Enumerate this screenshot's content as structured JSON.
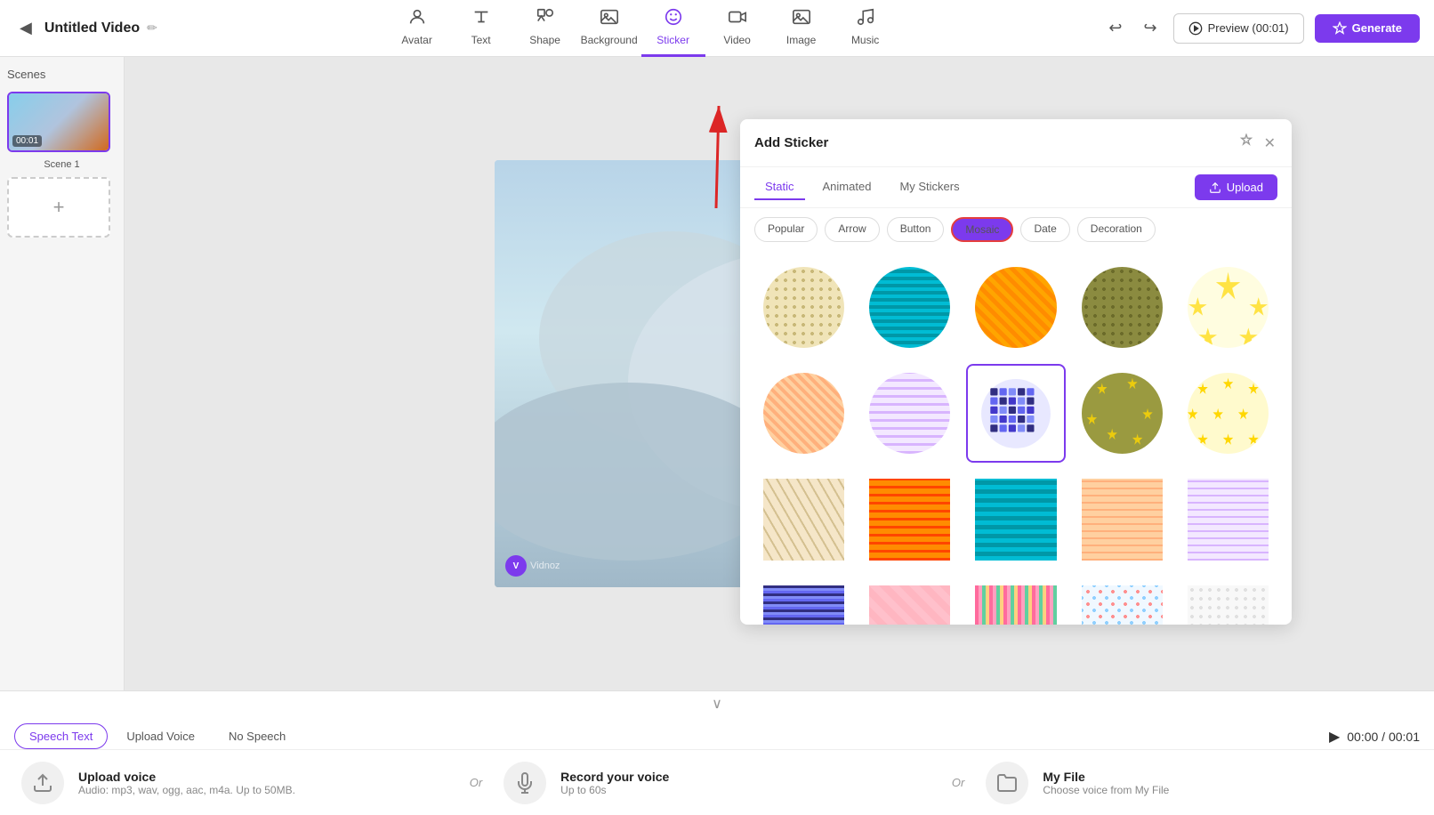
{
  "toolbar": {
    "back_icon": "◀",
    "title": "Untitled Video",
    "edit_icon": "✏",
    "tools": [
      {
        "id": "avatar",
        "icon": "👤",
        "label": "Avatar"
      },
      {
        "id": "text",
        "icon": "T",
        "label": "Text"
      },
      {
        "id": "shape",
        "icon": "⬡",
        "label": "Shape"
      },
      {
        "id": "background",
        "icon": "🖼",
        "label": "Background"
      },
      {
        "id": "sticker",
        "icon": "😊",
        "label": "Sticker",
        "active": true
      },
      {
        "id": "video",
        "icon": "▶",
        "label": "Video"
      },
      {
        "id": "image",
        "icon": "🖼",
        "label": "Image"
      },
      {
        "id": "music",
        "icon": "♪",
        "label": "Music"
      }
    ],
    "undo_icon": "↩",
    "redo_icon": "↪",
    "preview_label": "Preview (00:01)",
    "generate_label": "Generate"
  },
  "scenes": {
    "title": "Scenes",
    "items": [
      {
        "id": 1,
        "time": "00:01",
        "label": "Scene 1"
      }
    ],
    "add_label": "+"
  },
  "sticker_panel": {
    "title": "Add Sticker",
    "pin_icon": "📌",
    "close_icon": "✕",
    "tabs": [
      {
        "id": "static",
        "label": "Static",
        "active": true
      },
      {
        "id": "animated",
        "label": "Animated"
      },
      {
        "id": "my_stickers",
        "label": "My Stickers"
      }
    ],
    "upload_label": "Upload",
    "filters": [
      {
        "id": "popular",
        "label": "Popular"
      },
      {
        "id": "arrow",
        "label": "Arrow"
      },
      {
        "id": "button",
        "label": "Button"
      },
      {
        "id": "mosaic",
        "label": "Mosaic",
        "active": true
      },
      {
        "id": "date",
        "label": "Date"
      },
      {
        "id": "decoration",
        "label": "Decoration"
      }
    ],
    "stickers": [
      {
        "id": 1,
        "pattern": "mosaic-beige-dots",
        "shape": "circle"
      },
      {
        "id": 2,
        "pattern": "mosaic-cyan-wave",
        "shape": "circle"
      },
      {
        "id": 3,
        "pattern": "mosaic-orange-diamond",
        "shape": "circle"
      },
      {
        "id": 4,
        "pattern": "mosaic-olive-dots",
        "shape": "circle"
      },
      {
        "id": 5,
        "pattern": "mosaic-white-stars",
        "shape": "circle"
      },
      {
        "id": 6,
        "pattern": "mosaic-peach-mesh",
        "shape": "circle"
      },
      {
        "id": 7,
        "pattern": "mosaic-lavender-grid",
        "shape": "circle"
      },
      {
        "id": 8,
        "pattern": "mosaic-purple-pixel",
        "shape": "circle",
        "selected": true
      },
      {
        "id": 9,
        "pattern": "mosaic-olive-stars",
        "shape": "circle"
      },
      {
        "id": 10,
        "pattern": "mosaic-yellow-stars",
        "shape": "circle"
      },
      {
        "id": 11,
        "pattern": "mosaic-beige-tri",
        "shape": "square"
      },
      {
        "id": 12,
        "pattern": "mosaic-orange-grid",
        "shape": "square"
      },
      {
        "id": 13,
        "pattern": "mosaic-cyan-wave2",
        "shape": "square"
      },
      {
        "id": 14,
        "pattern": "mosaic-peach-grid",
        "shape": "square"
      },
      {
        "id": 15,
        "pattern": "mosaic-lavender-grid2",
        "shape": "square"
      },
      {
        "id": 16,
        "pattern": "mosaic-purple-pixel2",
        "shape": "square"
      },
      {
        "id": 17,
        "pattern": "mosaic-pink-check",
        "shape": "square"
      },
      {
        "id": 18,
        "pattern": "mosaic-multi-stripe",
        "shape": "square"
      },
      {
        "id": 19,
        "pattern": "mosaic-pastel-dots",
        "shape": "square"
      },
      {
        "id": 20,
        "pattern": "mosaic-white-dots2",
        "shape": "square"
      }
    ]
  },
  "bottom": {
    "expand_icon": "∨",
    "tabs": [
      {
        "id": "speech_text",
        "label": "Speech Text",
        "active": true
      },
      {
        "id": "upload_voice",
        "label": "Upload Voice"
      },
      {
        "id": "no_speech",
        "label": "No Speech"
      }
    ],
    "voice_options": [
      {
        "id": "upload",
        "icon": "⬆",
        "title": "Upload voice",
        "desc": "Audio: mp3, wav, ogg, aac, m4a. Up to 50MB."
      },
      {
        "id": "record",
        "icon": "🎤",
        "title": "Record your voice",
        "desc": "Up to 60s"
      },
      {
        "id": "my_file",
        "icon": "📁",
        "title": "My File",
        "desc": "Choose voice from My File"
      }
    ],
    "or_label": "Or",
    "time": "00:00 / 00:01",
    "play_icon": "▶"
  },
  "watermark": {
    "logo": "V",
    "text": "Vidnoz"
  }
}
